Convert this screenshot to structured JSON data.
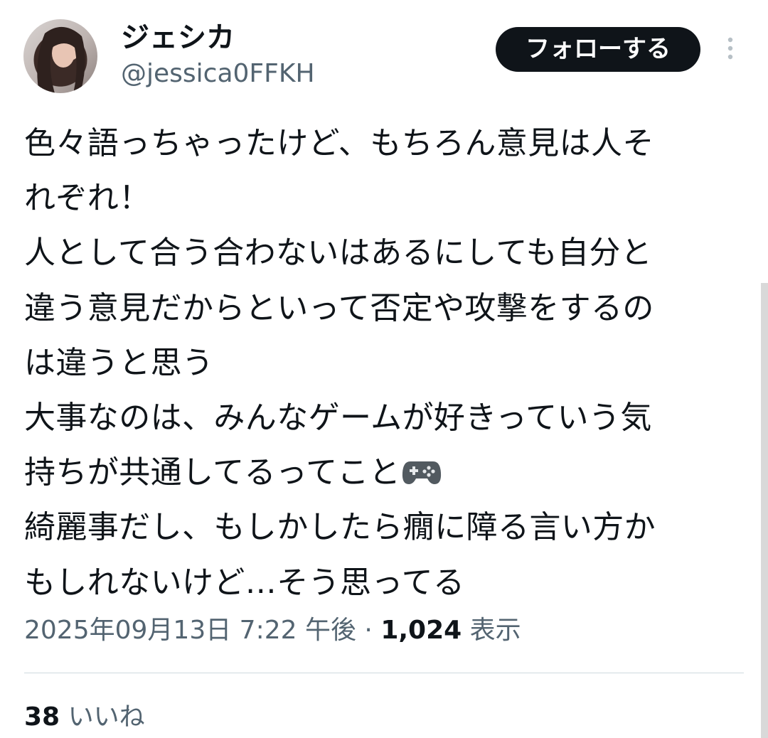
{
  "author": {
    "display_name": "ジェシカ",
    "handle": "@jessica0FFKH"
  },
  "follow_button": {
    "label": "フォローする"
  },
  "tweet": {
    "lines": [
      "色々語っちゃったけど、もちろん意見は人そ",
      "れぞれ！",
      "人として合う合わないはあるにしても自分と",
      "違う意見だからといって否定や攻撃をするの",
      "は違うと思う",
      "大事なのは、みんなゲームが好きっていう気",
      "持ちが共通してるってこと",
      "綺麗事だし、もしかしたら癇に障る言い方か",
      "もしれないけど…そう思ってる"
    ],
    "emoji": "video-game-controller"
  },
  "meta": {
    "timestamp": "2025年09月13日 7:22 午後",
    "separator": "·",
    "views_count": "1,024",
    "views_label": "表示"
  },
  "engagement": {
    "likes_count": "38",
    "likes_label": "いいね"
  },
  "icons": {
    "more": "more-vertical-icon"
  }
}
